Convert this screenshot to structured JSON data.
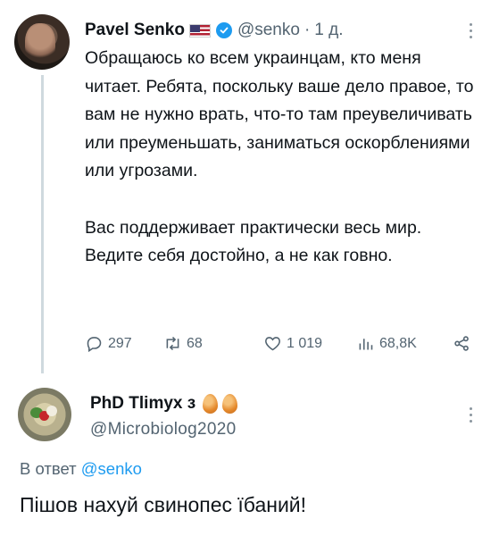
{
  "tweet": {
    "author": "Pavel Senko",
    "flag_icon": "us-flag-icon",
    "verified_icon": "verified-badge-icon",
    "handle": "@senko",
    "separator": "·",
    "time": "1 д.",
    "paragraphs": [
      "Обращаюсь ко всем украинцам, кто меня читает. Ребята, поскольку ваше дело правое, то вам не нужно врать, что-то там преувеличивать или преуменьшать, заниматься оскорблениями или угрозами.",
      "Вас поддерживает практически весь мир. Ведите себя достойно, а не как говно."
    ],
    "stats": {
      "replies": "297",
      "retweets": "68",
      "likes": "1 019",
      "views": "68,8K"
    },
    "colors": {
      "accent": "#1d9bf0",
      "muted": "#536471",
      "text": "#0f1419"
    }
  },
  "reply": {
    "author": "PhD Tlimyx з",
    "emoji_icon": "egg-icon",
    "handle": "@Microbiolog2020",
    "reply_to_label": "В ответ",
    "reply_to_handle": "@senko",
    "text": "Пішов нахуй свинопес їбаний!"
  }
}
